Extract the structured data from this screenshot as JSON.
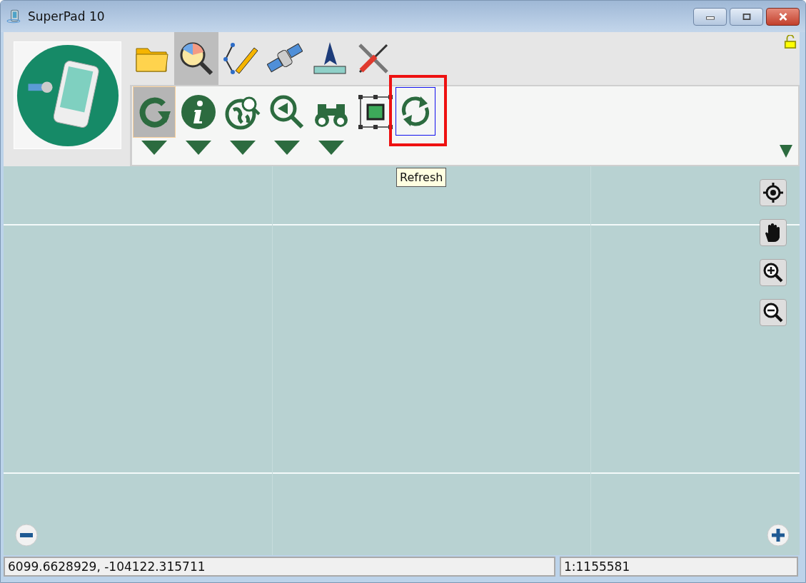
{
  "window": {
    "title": "SuperPad 10"
  },
  "tabs": [
    {
      "selected": false
    },
    {
      "selected": true
    },
    {
      "selected": false
    },
    {
      "selected": false
    },
    {
      "selected": false
    },
    {
      "selected": false
    }
  ],
  "tools": [
    {
      "selected": true,
      "menu": true,
      "focused": false,
      "highlighted": false
    },
    {
      "selected": false,
      "menu": true,
      "focused": false,
      "highlighted": false
    },
    {
      "selected": false,
      "menu": true,
      "focused": false,
      "highlighted": false
    },
    {
      "selected": false,
      "menu": true,
      "focused": false,
      "highlighted": false
    },
    {
      "selected": false,
      "menu": true,
      "focused": false,
      "highlighted": false
    },
    {
      "selected": false,
      "menu": false,
      "focused": false,
      "highlighted": false
    },
    {
      "selected": false,
      "menu": false,
      "focused": true,
      "highlighted": true
    }
  ],
  "tooltip": "Refresh",
  "status_bar": {
    "coordinates": "6099.6628929, -104122.315711",
    "scale": "1:1155581"
  }
}
